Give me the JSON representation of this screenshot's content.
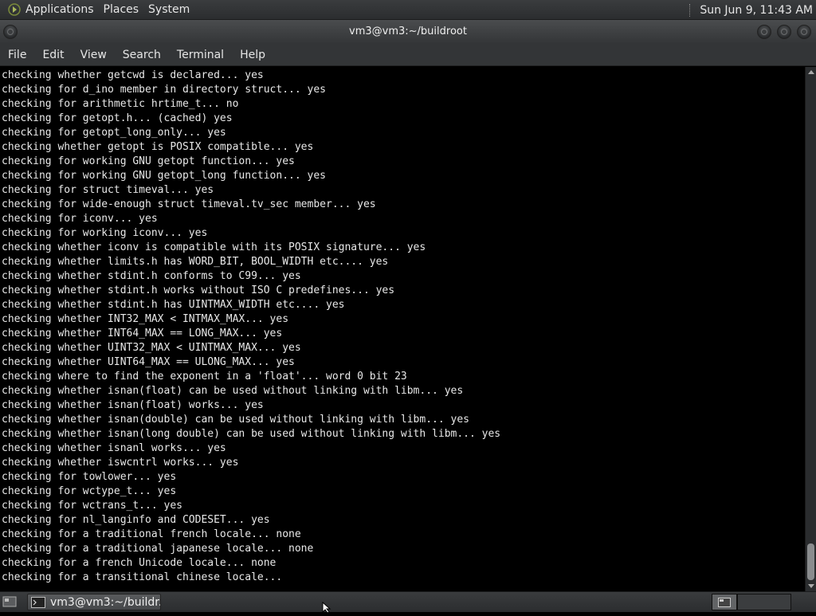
{
  "top_panel": {
    "menus": [
      "Applications",
      "Places",
      "System"
    ],
    "clock": "Sun Jun  9, 11:43 AM"
  },
  "window": {
    "title": "vm3@vm3:~/buildroot"
  },
  "menubar": {
    "items": [
      "File",
      "Edit",
      "View",
      "Search",
      "Terminal",
      "Help"
    ]
  },
  "terminal": {
    "lines": [
      "checking whether getcwd is declared... yes",
      "checking for d_ino member in directory struct... yes",
      "checking for arithmetic hrtime_t... no",
      "checking for getopt.h... (cached) yes",
      "checking for getopt_long_only... yes",
      "checking whether getopt is POSIX compatible... yes",
      "checking for working GNU getopt function... yes",
      "checking for working GNU getopt_long function... yes",
      "checking for struct timeval... yes",
      "checking for wide-enough struct timeval.tv_sec member... yes",
      "checking for iconv... yes",
      "checking for working iconv... yes",
      "checking whether iconv is compatible with its POSIX signature... yes",
      "checking whether limits.h has WORD_BIT, BOOL_WIDTH etc.... yes",
      "checking whether stdint.h conforms to C99... yes",
      "checking whether stdint.h works without ISO C predefines... yes",
      "checking whether stdint.h has UINTMAX_WIDTH etc.... yes",
      "checking whether INT32_MAX < INTMAX_MAX... yes",
      "checking whether INT64_MAX == LONG_MAX... yes",
      "checking whether UINT32_MAX < UINTMAX_MAX... yes",
      "checking whether UINT64_MAX == ULONG_MAX... yes",
      "checking where to find the exponent in a 'float'... word 0 bit 23",
      "checking whether isnan(float) can be used without linking with libm... yes",
      "checking whether isnan(float) works... yes",
      "checking whether isnan(double) can be used without linking with libm... yes",
      "checking whether isnan(long double) can be used without linking with libm... yes",
      "checking whether isnanl works... yes",
      "checking whether iswcntrl works... yes",
      "checking for towlower... yes",
      "checking for wctype_t... yes",
      "checking for wctrans_t... yes",
      "checking for nl_langinfo and CODESET... yes",
      "checking for a traditional french locale... none",
      "checking for a traditional japanese locale... none",
      "checking for a french Unicode locale... none",
      "checking for a transitional chinese locale..."
    ]
  },
  "taskbar": {
    "task_label": "vm3@vm3:~/buildr..."
  },
  "icons": {
    "apps": "applications-icon",
    "show_desktop": "show-desktop-icon",
    "task": "terminal-icon",
    "workspace": "workspace-icon",
    "cursor": "mouse-pointer-icon"
  },
  "colors": {
    "terminal_bg": "#000000",
    "terminal_fg": "#e8e8e8",
    "panel_bg": "#333537"
  }
}
